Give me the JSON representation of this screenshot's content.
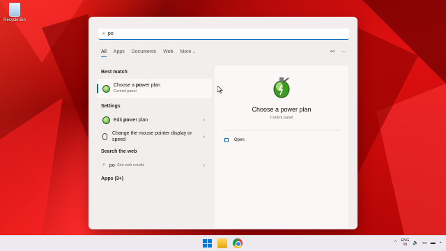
{
  "desktop": {
    "recycle_bin_label": "Recycle Bin"
  },
  "search": {
    "value": "po",
    "icon": "search-icon"
  },
  "tabs": [
    {
      "label": "All",
      "active": true
    },
    {
      "label": "Apps",
      "active": false
    },
    {
      "label": "Documents",
      "active": false
    },
    {
      "label": "Web",
      "active": false
    },
    {
      "label": "More",
      "active": false
    }
  ],
  "sections": {
    "best_match": "Best match",
    "settings": "Settings",
    "search_web": "Search the web",
    "apps": "Apps (3+)"
  },
  "best_match": {
    "title_prefix": "Choose a ",
    "title_bold": "po",
    "title_suffix": "wer plan",
    "subtitle": "Control panel"
  },
  "settings_items": [
    {
      "label_prefix": "Edit ",
      "label_bold": "po",
      "label_suffix": "wer plan"
    },
    {
      "label": "Change the mouse pointer display or speed"
    }
  ],
  "web_item": {
    "query": "po",
    "suffix": " - See web results"
  },
  "detail": {
    "title": "Choose a power plan",
    "subtitle": "Control panel",
    "open_label": "Open"
  },
  "tray": {
    "lang_top": "ENG",
    "lang_bottom": "IN"
  }
}
